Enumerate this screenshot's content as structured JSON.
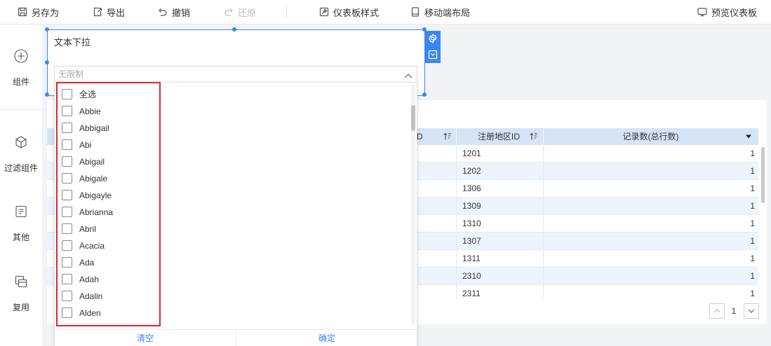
{
  "colors": {
    "accent": "#3b86f0",
    "highlight": "#e0262b",
    "table_header_bg": "#d6e4f7",
    "row_alt_bg": "#eef4fc"
  },
  "toolbar": {
    "save_as": {
      "label": "另存为",
      "icon": "save-as-icon"
    },
    "export": {
      "label": "导出",
      "icon": "export-icon"
    },
    "undo": {
      "label": "撤销",
      "icon": "undo-icon"
    },
    "redo": {
      "label": "还原",
      "icon": "redo-icon",
      "disabled": true
    },
    "dashboard_style": {
      "label": "仪表板样式",
      "icon": "dashboard-style-icon"
    },
    "mobile_layout": {
      "label": "移动端布局",
      "icon": "mobile-icon"
    },
    "preview": {
      "label": "预览仪表板",
      "icon": "monitor-icon"
    }
  },
  "sidebar": {
    "items": [
      {
        "label": "组件",
        "icon": "plus-circle-icon"
      },
      {
        "label": "过滤组件",
        "icon": "cube-icon"
      },
      {
        "label": "其他",
        "icon": "document-icon"
      },
      {
        "label": "复用",
        "icon": "copy-icon"
      }
    ]
  },
  "filter_widget": {
    "title": "文本下拉",
    "placeholder": "无限制"
  },
  "dropdown": {
    "select_all": "全选",
    "options": [
      "Abbie",
      "Abbigail",
      "Abi",
      "Abigail",
      "Abigale",
      "Abigayle",
      "Abrianna",
      "Abril",
      "Acacia",
      "Ada",
      "Adah",
      "Adalin",
      "Alden"
    ],
    "clear_label": "清空",
    "confirm_label": "确定"
  },
  "table": {
    "columns": [
      "D",
      "注册地区ID",
      "记录数(总行数)"
    ],
    "rows": [
      {
        "region_id": "1201",
        "count": "1"
      },
      {
        "region_id": "1202",
        "count": "1"
      },
      {
        "region_id": "1306",
        "count": "1"
      },
      {
        "region_id": "1309",
        "count": "1"
      },
      {
        "region_id": "1310",
        "count": "1"
      },
      {
        "region_id": "1307",
        "count": "1"
      },
      {
        "region_id": "1311",
        "count": "1"
      },
      {
        "region_id": "2310",
        "count": "1"
      },
      {
        "region_id": "2311",
        "count": "1"
      }
    ]
  },
  "pagination": {
    "current_page": "1"
  }
}
